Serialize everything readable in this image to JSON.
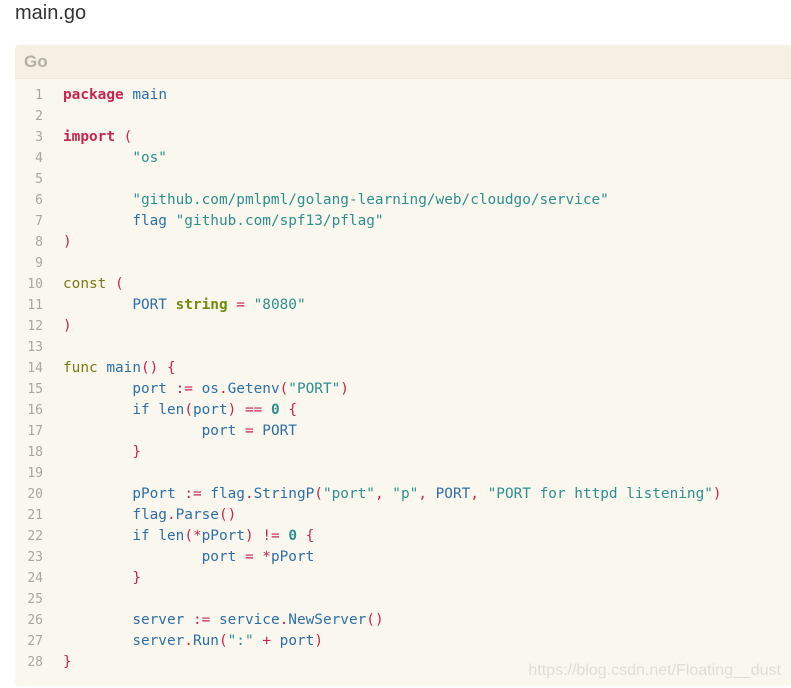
{
  "page": {
    "title": "main.go"
  },
  "code_block": {
    "language": "Go",
    "watermark": "https://blog.csdn.net/Floating__dust",
    "lines": [
      {
        "n": "1",
        "tokens": [
          [
            "kw",
            "package"
          ],
          [
            "ws",
            " "
          ],
          [
            "ident",
            "main"
          ]
        ]
      },
      {
        "n": "2",
        "tokens": []
      },
      {
        "n": "3",
        "tokens": [
          [
            "kw",
            "import"
          ],
          [
            "ws",
            " "
          ],
          [
            "op",
            "("
          ]
        ]
      },
      {
        "n": "4",
        "tokens": [
          [
            "ws",
            "        "
          ],
          [
            "str",
            "\"os\""
          ]
        ]
      },
      {
        "n": "5",
        "tokens": []
      },
      {
        "n": "6",
        "tokens": [
          [
            "ws",
            "        "
          ],
          [
            "str",
            "\"github.com/pmlpml/golang-learning/web/cloudgo/service\""
          ]
        ]
      },
      {
        "n": "7",
        "tokens": [
          [
            "ws",
            "        "
          ],
          [
            "ident",
            "flag"
          ],
          [
            "ws",
            " "
          ],
          [
            "str",
            "\"github.com/spf13/pflag\""
          ]
        ]
      },
      {
        "n": "8",
        "tokens": [
          [
            "op",
            ")"
          ]
        ]
      },
      {
        "n": "9",
        "tokens": []
      },
      {
        "n": "10",
        "tokens": [
          [
            "kw2",
            "const"
          ],
          [
            "ws",
            " "
          ],
          [
            "op",
            "("
          ]
        ]
      },
      {
        "n": "11",
        "tokens": [
          [
            "ws",
            "        "
          ],
          [
            "ident",
            "PORT"
          ],
          [
            "ws",
            " "
          ],
          [
            "type",
            "string"
          ],
          [
            "ws",
            " "
          ],
          [
            "op",
            "="
          ],
          [
            "ws",
            " "
          ],
          [
            "str",
            "\"8080\""
          ]
        ]
      },
      {
        "n": "12",
        "tokens": [
          [
            "op",
            ")"
          ]
        ]
      },
      {
        "n": "13",
        "tokens": []
      },
      {
        "n": "14",
        "tokens": [
          [
            "kw2",
            "func"
          ],
          [
            "ws",
            " "
          ],
          [
            "ident",
            "main"
          ],
          [
            "op",
            "()"
          ],
          [
            "ws",
            " "
          ],
          [
            "op",
            "{"
          ]
        ]
      },
      {
        "n": "15",
        "tokens": [
          [
            "ws",
            "        "
          ],
          [
            "ident",
            "port"
          ],
          [
            "ws",
            " "
          ],
          [
            "op",
            ":="
          ],
          [
            "ws",
            " "
          ],
          [
            "ident",
            "os"
          ],
          [
            "op",
            "."
          ],
          [
            "ident",
            "Getenv"
          ],
          [
            "op",
            "("
          ],
          [
            "str",
            "\"PORT\""
          ],
          [
            "op",
            ")"
          ]
        ]
      },
      {
        "n": "16",
        "tokens": [
          [
            "ws",
            "        "
          ],
          [
            "ident",
            "if"
          ],
          [
            "ws",
            " "
          ],
          [
            "ident",
            "len"
          ],
          [
            "op",
            "("
          ],
          [
            "ident",
            "port"
          ],
          [
            "op",
            ")"
          ],
          [
            "ws",
            " "
          ],
          [
            "op",
            "=="
          ],
          [
            "ws",
            " "
          ],
          [
            "num",
            "0"
          ],
          [
            "ws",
            " "
          ],
          [
            "op",
            "{"
          ]
        ]
      },
      {
        "n": "17",
        "tokens": [
          [
            "ws",
            "                "
          ],
          [
            "ident",
            "port"
          ],
          [
            "ws",
            " "
          ],
          [
            "op",
            "="
          ],
          [
            "ws",
            " "
          ],
          [
            "ident",
            "PORT"
          ]
        ]
      },
      {
        "n": "18",
        "tokens": [
          [
            "ws",
            "        "
          ],
          [
            "op",
            "}"
          ]
        ]
      },
      {
        "n": "19",
        "tokens": []
      },
      {
        "n": "20",
        "tokens": [
          [
            "ws",
            "        "
          ],
          [
            "ident",
            "pPort"
          ],
          [
            "ws",
            " "
          ],
          [
            "op",
            ":="
          ],
          [
            "ws",
            " "
          ],
          [
            "ident",
            "flag"
          ],
          [
            "op",
            "."
          ],
          [
            "ident",
            "StringP"
          ],
          [
            "op",
            "("
          ],
          [
            "str",
            "\"port\""
          ],
          [
            "op",
            ","
          ],
          [
            "ws",
            " "
          ],
          [
            "str",
            "\"p\""
          ],
          [
            "op",
            ","
          ],
          [
            "ws",
            " "
          ],
          [
            "ident",
            "PORT"
          ],
          [
            "op",
            ","
          ],
          [
            "ws",
            " "
          ],
          [
            "str",
            "\"PORT for httpd listening\""
          ],
          [
            "op",
            ")"
          ]
        ]
      },
      {
        "n": "21",
        "tokens": [
          [
            "ws",
            "        "
          ],
          [
            "ident",
            "flag"
          ],
          [
            "op",
            "."
          ],
          [
            "ident",
            "Parse"
          ],
          [
            "op",
            "()"
          ]
        ]
      },
      {
        "n": "22",
        "tokens": [
          [
            "ws",
            "        "
          ],
          [
            "ident",
            "if"
          ],
          [
            "ws",
            " "
          ],
          [
            "ident",
            "len"
          ],
          [
            "op",
            "(*"
          ],
          [
            "ident",
            "pPort"
          ],
          [
            "op",
            ")"
          ],
          [
            "ws",
            " "
          ],
          [
            "op",
            "!="
          ],
          [
            "ws",
            " "
          ],
          [
            "num",
            "0"
          ],
          [
            "ws",
            " "
          ],
          [
            "op",
            "{"
          ]
        ]
      },
      {
        "n": "23",
        "tokens": [
          [
            "ws",
            "                "
          ],
          [
            "ident",
            "port"
          ],
          [
            "ws",
            " "
          ],
          [
            "op",
            "="
          ],
          [
            "ws",
            " "
          ],
          [
            "op",
            "*"
          ],
          [
            "ident",
            "pPort"
          ]
        ]
      },
      {
        "n": "24",
        "tokens": [
          [
            "ws",
            "        "
          ],
          [
            "op",
            "}"
          ]
        ]
      },
      {
        "n": "25",
        "tokens": []
      },
      {
        "n": "26",
        "tokens": [
          [
            "ws",
            "        "
          ],
          [
            "ident",
            "server"
          ],
          [
            "ws",
            " "
          ],
          [
            "op",
            ":="
          ],
          [
            "ws",
            " "
          ],
          [
            "ident",
            "service"
          ],
          [
            "op",
            "."
          ],
          [
            "ident",
            "NewServer"
          ],
          [
            "op",
            "()"
          ]
        ]
      },
      {
        "n": "27",
        "tokens": [
          [
            "ws",
            "        "
          ],
          [
            "ident",
            "server"
          ],
          [
            "op",
            "."
          ],
          [
            "ident",
            "Run"
          ],
          [
            "op",
            "("
          ],
          [
            "str",
            "\":\""
          ],
          [
            "ws",
            " "
          ],
          [
            "op",
            "+"
          ],
          [
            "ws",
            " "
          ],
          [
            "ident",
            "port"
          ],
          [
            "op",
            ")"
          ]
        ]
      },
      {
        "n": "28",
        "tokens": [
          [
            "op",
            "}"
          ]
        ]
      }
    ]
  }
}
